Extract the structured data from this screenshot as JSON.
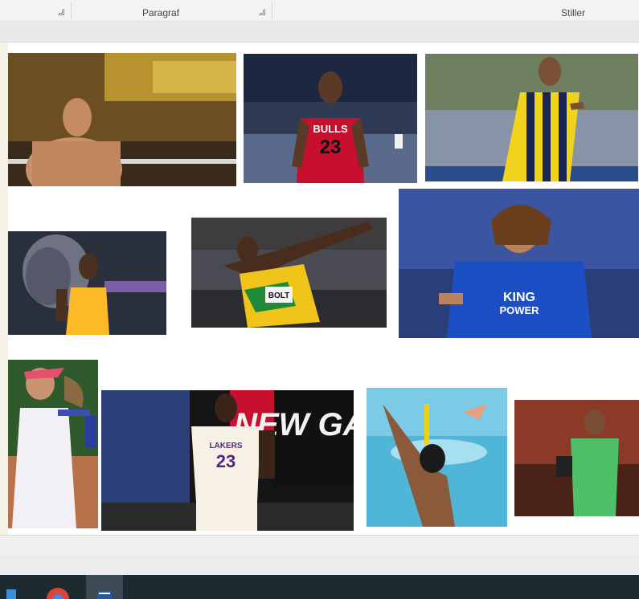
{
  "ribbon": {
    "groups": [
      {
        "label": "",
        "has_launcher": true
      },
      {
        "label": "Paragraf",
        "has_launcher": true
      },
      {
        "label": "Stiller",
        "has_launcher": false
      }
    ]
  },
  "document": {
    "images": [
      {
        "name": "mma-fighter-photo",
        "description": ""
      },
      {
        "name": "bulls-23-player-photo",
        "jersey_text": "BULLS",
        "number": "23"
      },
      {
        "name": "yellow-navy-football-player-photo",
        "description": ""
      },
      {
        "name": "basketball-player-tribute-photo",
        "description": ""
      },
      {
        "name": "sprinter-photo",
        "bib": "BOLT"
      },
      {
        "name": "blue-football-player-photo",
        "sponsor_line1": "KING",
        "sponsor_line2": "POWER"
      },
      {
        "name": "tennis-player-photo",
        "description": ""
      },
      {
        "name": "lakers-23-player-photo",
        "jersey_text": "LAKERS",
        "number": "23",
        "backdrop": "NEW GAM"
      },
      {
        "name": "swimmer-photo",
        "description": ""
      },
      {
        "name": "goalkeeper-photo",
        "description": ""
      }
    ]
  },
  "taskbar": {
    "items": [
      {
        "icon": "windows-icon"
      },
      {
        "icon": "chrome-icon"
      },
      {
        "icon": "word-icon",
        "active": true
      }
    ]
  },
  "colors": {
    "ribbon_bg": "#f3f3f3",
    "taskbar_bg": "#1d2a30",
    "bulls_red": "#c8102e",
    "lakers_gold": "#fdb927",
    "leicester_blue": "#1b4fc3"
  }
}
